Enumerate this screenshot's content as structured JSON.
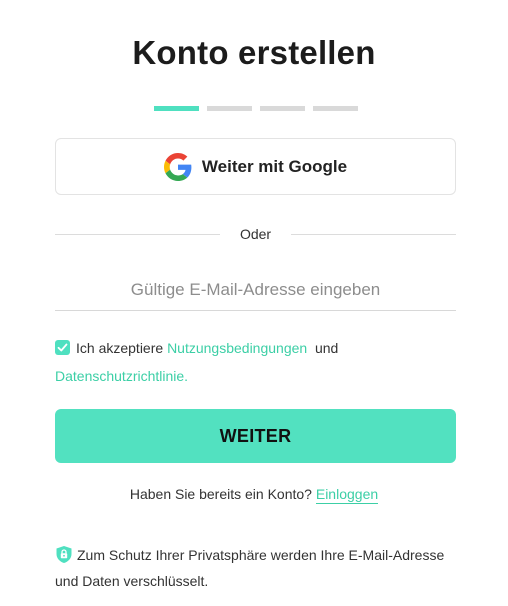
{
  "header": {
    "title": "Konto erstellen",
    "steps": {
      "total": 4,
      "active": 1,
      "active_color": "#4fe0c0",
      "inactive_color": "#d9d9d9"
    }
  },
  "google_button": {
    "label": "Weiter mit Google",
    "icon": "google-icon"
  },
  "divider": {
    "label": "Oder"
  },
  "email_field": {
    "value": "",
    "placeholder": "Gültige E-Mail-Adresse eingeben"
  },
  "terms": {
    "checked": true,
    "prefix": "Ich akzeptiere",
    "terms_link": "Nutzungsbedingungen",
    "conjunction": "und",
    "privacy_link": "Datenschutzrichtlinie."
  },
  "submit_button": {
    "label": "WEITER",
    "color": "#52e1c0"
  },
  "login": {
    "question": "Haben Sie bereits ein Konto?",
    "link": "Einloggen"
  },
  "privacy_note": {
    "icon": "shield-lock-icon",
    "text": "Zum Schutz Ihrer Privatsphäre werden Ihre E-Mail-Adresse und Daten verschlüsselt."
  },
  "accent_color": "#3ccfa6"
}
